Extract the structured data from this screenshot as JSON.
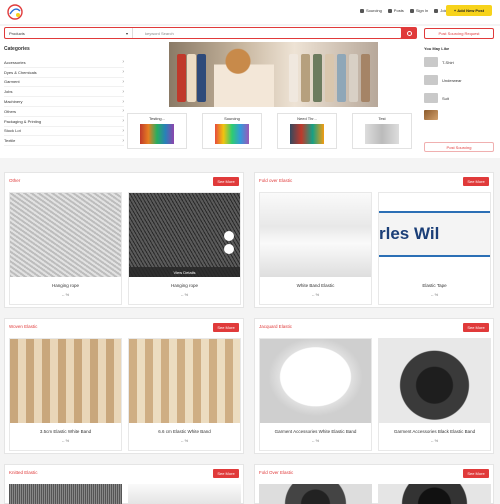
{
  "header": {
    "nav": [
      "Sourcing",
      "Posts",
      "Sign In",
      "Join Free"
    ],
    "post_btn": "+ Add New Post"
  },
  "search": {
    "category": "Products",
    "placeholder": "keyword Search",
    "post_sourcing": "Post Sourcing Request"
  },
  "categories": {
    "title": "Categories",
    "items": [
      "Accessories",
      "Dyes & Chemicals",
      "Garment",
      "Jobs",
      "Machinery",
      "Others",
      "Packaging & Printing",
      "Stock Lot",
      "Textile"
    ]
  },
  "tiles": [
    "Testing...",
    "Sourcing",
    "Need Thr...",
    "Test"
  ],
  "maylike": {
    "title": "You May Like",
    "items": [
      "T-Shirt",
      "Underwear",
      "Suit",
      ""
    ],
    "post_sourcing": "Post Sourcing"
  },
  "sections": [
    {
      "title": "Other",
      "more": "See More",
      "cards": [
        {
          "name": "Hanging rope",
          "price": "-- %"
        },
        {
          "name": "Hanging rope",
          "price": "-- %",
          "view": "View Details"
        }
      ]
    },
    {
      "title": "Fold over Elastic",
      "more": "See More",
      "cards": [
        {
          "name": "White Band Elastic",
          "price": "-- %"
        },
        {
          "name": "Elastic Tape",
          "price": "-- %"
        }
      ]
    },
    {
      "title": "Woven Elastic",
      "more": "See More",
      "cards": [
        {
          "name": "3.5cm Elastic White Band",
          "price": "-- %"
        },
        {
          "name": "6.6 cm Elastic White Band",
          "price": "-- %"
        }
      ]
    },
    {
      "title": "Jacquard Elastic",
      "more": "See More",
      "cards": [
        {
          "name": "Garment Accessories White Elastic Band",
          "price": "-- %"
        },
        {
          "name": "Garment Accessories Black Elastic Band",
          "price": "-- %"
        }
      ]
    },
    {
      "title": "Knitted Elastic",
      "more": "See More",
      "cards": []
    },
    {
      "title": "Fold Over Elastic",
      "more": "See More",
      "cards": []
    }
  ],
  "elastic_tape_text": "rles Wil"
}
